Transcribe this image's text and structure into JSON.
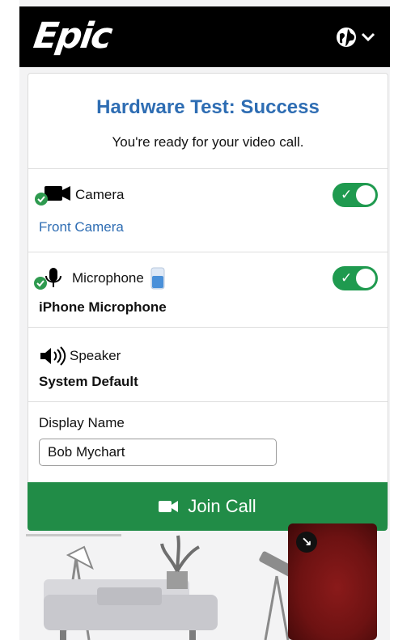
{
  "header": {
    "logo": "Epic",
    "language_icon": "globe-icon",
    "dropdown_icon": "chevron-down-icon"
  },
  "card": {
    "title": "Hardware Test: Success",
    "subtitle": "You're ready for your video call.",
    "camera": {
      "label": "Camera",
      "value": "Front Camera",
      "enabled": true,
      "status_icon": "check-circle-icon",
      "icon": "video-camera-icon"
    },
    "microphone": {
      "label": "Microphone",
      "value": "iPhone Microphone",
      "enabled": true,
      "status_icon": "check-circle-icon",
      "icon": "microphone-icon",
      "level_icon": "mic-level-icon"
    },
    "speaker": {
      "label": "Speaker",
      "value": "System Default",
      "icon": "speaker-icon"
    },
    "display_name": {
      "label": "Display Name",
      "value": "Bob Mychart"
    }
  },
  "join_button": {
    "label": "Join Call",
    "icon": "video-camera-icon"
  },
  "self_view": {
    "expand_icon": "expand-arrow-icon"
  },
  "colors": {
    "accent": "#2e6db3",
    "success": "#218c47",
    "toggle": "#1f9a4f",
    "header": "#000000"
  }
}
